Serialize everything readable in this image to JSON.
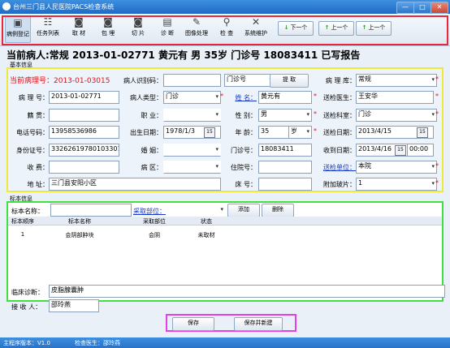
{
  "window": {
    "title": "台州三门县人民医院PACS检查系统",
    "min": "—",
    "max": "□",
    "close": "✕"
  },
  "toolbar": {
    "items": [
      "病例登记",
      "任务列表",
      "取 材",
      "包 埋",
      "切 片",
      "诊 断",
      "图像处理",
      "检 查",
      "系统维护"
    ],
    "icons": [
      "register-icon",
      "task-list-icon",
      "camera-icon",
      "camera-icon",
      "camera-icon",
      "document-icon",
      "image-process-icon",
      "search-icon",
      "tools-icon"
    ],
    "nav": [
      "下一个",
      "上一个",
      "上一个"
    ]
  },
  "patient_bar": "当前病人:常规    2013-01-02771  黄元有  男  35岁  门诊号  18083411  已写报告",
  "basic": {
    "title": "基本信息",
    "current_pathology": "当前病理号：2013-01-03015",
    "patient_id_label": "病人识别码：",
    "patient_id": "",
    "id_type": "门诊号",
    "fetch": "提 取",
    "library_label": "病 理 库：",
    "library": "常规",
    "pathology_no_label": "病 理 号：",
    "pathology_no": "2013-01-02771",
    "patient_type_label": "病人类型：",
    "patient_type": "门诊",
    "name_label": "姓  名：",
    "name": "黄元有",
    "doctor_label": "送检医生：",
    "doctor": "王安华",
    "native_label": "籍    贯：",
    "native": "",
    "job_label": "职    业：",
    "job": "",
    "sex_label": "性  别：",
    "sex": "男",
    "dept_label": "送检科室：",
    "dept": "门诊",
    "phone_label": "电话号码：",
    "phone": "13958536986",
    "birth_label": "出生日期：",
    "birth": "1978/1/3",
    "age_label": "年  龄：",
    "age": "35",
    "age_unit": "岁",
    "send_date_label": "送检日期：",
    "send_date": "2013/4/15",
    "idcard_label": "身份证号：",
    "idcard": "33262619780103301",
    "marriage_label": "婚    姻：",
    "marriage": "",
    "outpatient_label": "门诊号：",
    "outpatient": "18083411",
    "recv_date_label": "收到日期：",
    "recv_date": "2013/4/16",
    "recv_time": "00:00",
    "fee_label": "收    费：",
    "fee": "",
    "ward_label": "病    区：",
    "ward": "",
    "inpatient_label": "住院号：",
    "inpatient": "",
    "send_unit_label": "送检单位：",
    "send_unit": "本院",
    "addr_label": "地    址：",
    "addr": "三门县安阳小区",
    "bed_label": "床  号：",
    "bed": "",
    "extra_slides_label": "附加玻片：",
    "extra_slides": "1",
    "cal": "15"
  },
  "sample": {
    "title": "标本信息",
    "name_label": "标本名称：",
    "name_value": "",
    "site_label": "采取部位：",
    "site_value": "",
    "add": "添加",
    "delete": "删除",
    "columns": [
      "标本顺序",
      "标本名称",
      "采取部位",
      "状态"
    ],
    "rows": [
      [
        "1",
        "会阴部肿块",
        "会阴",
        "未取材"
      ]
    ],
    "diagnosis_label": "临床诊断：",
    "diagnosis": "皮脂腺囊肿",
    "receiver_label": "接 收 人：",
    "receiver": "邵玲燕"
  },
  "actions": {
    "save": "保存",
    "save_new": "保存并新建"
  },
  "status": {
    "version": "主程序版本：V1.0",
    "doctor": "检查医生：邵玲燕"
  }
}
